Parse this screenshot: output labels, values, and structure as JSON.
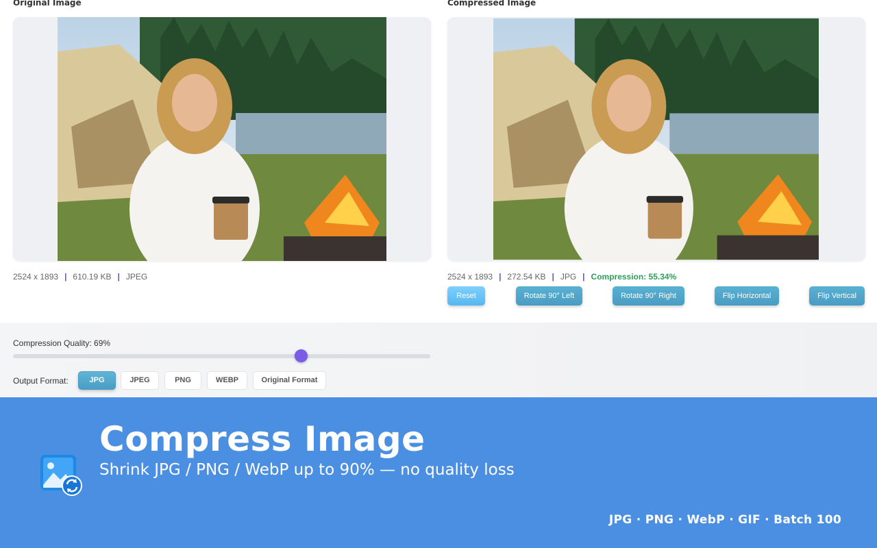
{
  "original": {
    "title": "Original Image",
    "dimensions": "2524 x 1893",
    "size": "610.19 KB",
    "format": "JPEG"
  },
  "compressed": {
    "title": "Compressed Image",
    "dimensions": "2524 x 1893",
    "size": "272.54 KB",
    "format": "JPG",
    "compression": "Compression: 55.34%"
  },
  "actions": {
    "reset": "Reset",
    "rotate_left": "Rotate 90° Left",
    "rotate_right": "Rotate 90° Right",
    "flip_horizontal": "Flip Horizontal",
    "flip_vertical": "Flip Vertical"
  },
  "quality": {
    "label": "Compression Quality: 69%",
    "value": 0.69
  },
  "output_format": {
    "label": "Output Format:",
    "options": [
      "JPG",
      "JPEG",
      "PNG",
      "WEBP",
      "Original Format"
    ],
    "selected": "JPG"
  },
  "banner": {
    "title": "Compress Image",
    "subtitle": "Shrink JPG / PNG / WebP up to 90% — no quality loss",
    "formats": "JPG · PNG · WebP · GIF · Batch 100",
    "icon": "image-convert-icon"
  },
  "colors": {
    "accent": "#7b5ce6",
    "button": "#4a9cc2",
    "success": "#2e9d5c",
    "banner": "#4a8fe2"
  }
}
